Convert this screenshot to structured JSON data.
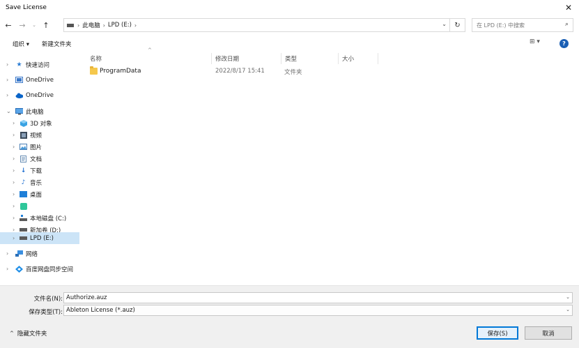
{
  "window": {
    "title": "Save License",
    "close_glyph": "✕"
  },
  "address": {
    "path": [
      "此电脑",
      "LPD (E:)"
    ],
    "separators": [
      "›",
      "›",
      "›"
    ],
    "search_placeholder": "在 LPD (E:) 中搜索"
  },
  "toolbar": {
    "organize": "组织 ▾",
    "new_folder": "新建文件夹",
    "view": "⊞ ▾",
    "help": "?"
  },
  "nav": {
    "quick_access": "快速访问",
    "onedrive_personal": "OneDrive",
    "onedrive": "OneDrive",
    "this_pc": "此电脑",
    "objects3d": "3D 对象",
    "videos": "视频",
    "pictures": "图片",
    "documents": "文档",
    "downloads": "下载",
    "music": "音乐",
    "desktop": "桌面",
    "unnamed": "",
    "local_c": "本地磁盘 (C:)",
    "new_d": "新加卷 (D:)",
    "lpd_e": "LPD (E:)",
    "network": "网络",
    "baidu": "百度网盘同步空间"
  },
  "columns": {
    "name": "名称",
    "modified": "修改日期",
    "type": "类型",
    "size": "大小"
  },
  "files": [
    {
      "name": "ProgramData",
      "modified": "2022/8/17 15:41",
      "type": "文件夹",
      "size": ""
    }
  ],
  "form": {
    "filename_label": "文件名(N):",
    "filename_value": "Authorize.auz",
    "filetype_label": "保存类型(T):",
    "filetype_value": "Ableton License (*.auz)",
    "hide_folders": "隐藏文件夹",
    "save": "保存(S)",
    "cancel": "取消"
  }
}
